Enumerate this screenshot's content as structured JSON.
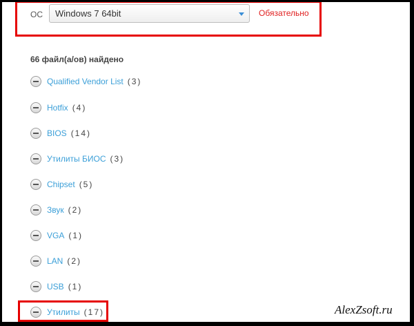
{
  "filter": {
    "os_label": "ОС",
    "os_value": "Windows 7 64bit",
    "required_text": "Обязательно"
  },
  "results": {
    "count_title": "66 файл(а/ов) найдено"
  },
  "categories": [
    {
      "label": "Qualified Vendor List",
      "count": "(3)"
    },
    {
      "label": "Hotfix",
      "count": "(4)"
    },
    {
      "label": "BIOS",
      "count": "(14)"
    },
    {
      "label": "Утилиты БИОС",
      "count": "(3)"
    },
    {
      "label": "Chipset",
      "count": "(5)"
    },
    {
      "label": "Звук",
      "count": "(2)"
    },
    {
      "label": "VGA",
      "count": "(1)"
    },
    {
      "label": "LAN",
      "count": "(2)"
    },
    {
      "label": "USB",
      "count": "(1)"
    },
    {
      "label": "Утилиты",
      "count": "(17)"
    }
  ],
  "watermark": "AlexZsoft.ru",
  "colors": {
    "link": "#3b9fd8",
    "highlight": "#e60000",
    "required": "#e02020"
  }
}
